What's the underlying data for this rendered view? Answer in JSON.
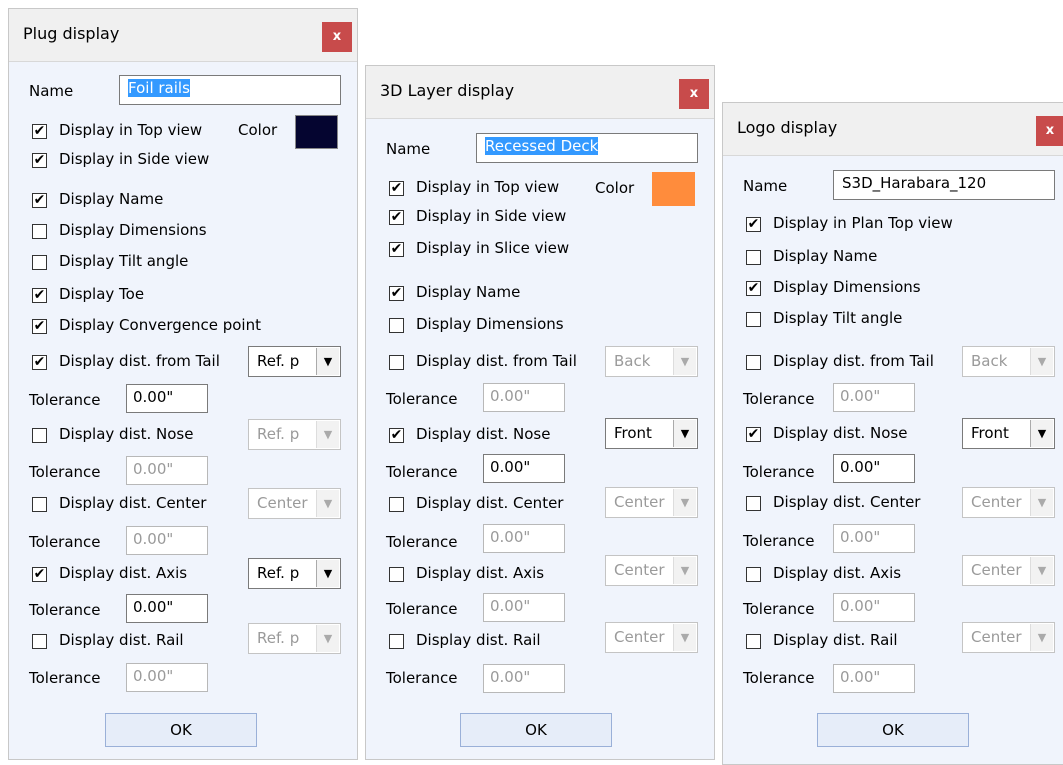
{
  "plug": {
    "title": "Plug display",
    "close": "x",
    "name_label": "Name",
    "name_value": "Foil rails",
    "color_label": "Color",
    "color_value": "#050530",
    "top_view": "Display in Top view",
    "side_view": "Display in Side view",
    "display_name": "Display Name",
    "display_dimensions": "Display Dimensions",
    "display_tilt": "Display Tilt angle",
    "display_toe": "Display Toe",
    "display_convergence": "Display Convergence point",
    "dist_tail": "Display dist. from Tail",
    "dist_tail_select": "Ref. p",
    "dist_nose": "Display dist. Nose",
    "dist_nose_select": "Ref. p",
    "dist_center": "Display dist. Center",
    "dist_center_select": "Center",
    "dist_axis": "Display dist. Axis",
    "dist_axis_select": "Ref. p",
    "dist_rail": "Display dist. Rail",
    "dist_rail_select": "Ref. p",
    "tolerance_label": "Tolerance",
    "tol_tail": "0.00\"",
    "tol_nose": "0.00\"",
    "tol_center": "0.00\"",
    "tol_axis": "0.00\"",
    "tol_rail": "0.00\"",
    "ok": "OK"
  },
  "layer": {
    "title": "3D Layer display",
    "close": "x",
    "name_label": "Name",
    "name_value": "Recessed Deck",
    "color_label": "Color",
    "color_value": "#ff8c3c",
    "top_view": "Display in Top view",
    "side_view": "Display in Side view",
    "slice_view": "Display in Slice view",
    "display_name": "Display Name",
    "display_dimensions": "Display Dimensions",
    "dist_tail": "Display dist. from Tail",
    "dist_tail_select": "Back",
    "dist_nose": "Display dist. Nose",
    "dist_nose_select": "Front",
    "dist_center": "Display dist. Center",
    "dist_center_select": "Center",
    "dist_axis": "Display dist. Axis",
    "dist_axis_select": "Center",
    "dist_rail": "Display dist. Rail",
    "dist_rail_select": "Center",
    "tolerance_label": "Tolerance",
    "tol_tail": "0.00\"",
    "tol_nose": "0.00\"",
    "tol_center": "0.00\"",
    "tol_axis": "0.00\"",
    "tol_rail": "0.00\"",
    "ok": "OK"
  },
  "logo": {
    "title": "Logo display",
    "close": "x",
    "name_label": "Name",
    "name_value": "S3D_Harabara_120",
    "plan_top_view": "Display in Plan Top view",
    "display_name": "Display Name",
    "display_dimensions": "Display Dimensions",
    "display_tilt": "Display Tilt angle",
    "dist_tail": "Display dist. from Tail",
    "dist_tail_select": "Back",
    "dist_nose": "Display dist. Nose",
    "dist_nose_select": "Front",
    "dist_center": "Display dist. Center",
    "dist_center_select": "Center",
    "dist_axis": "Display dist. Axis",
    "dist_axis_select": "Center",
    "dist_rail": "Display dist. Rail",
    "dist_rail_select": "Center",
    "tolerance_label": "Tolerance",
    "tol_tail": "0.00\"",
    "tol_nose": "0.00\"",
    "tol_center": "0.00\"",
    "tol_axis": "0.00\"",
    "tol_rail": "0.00\"",
    "ok": "OK"
  },
  "checks": {
    "checked_mark": "✔",
    "dropdown_arrow": "▼"
  }
}
